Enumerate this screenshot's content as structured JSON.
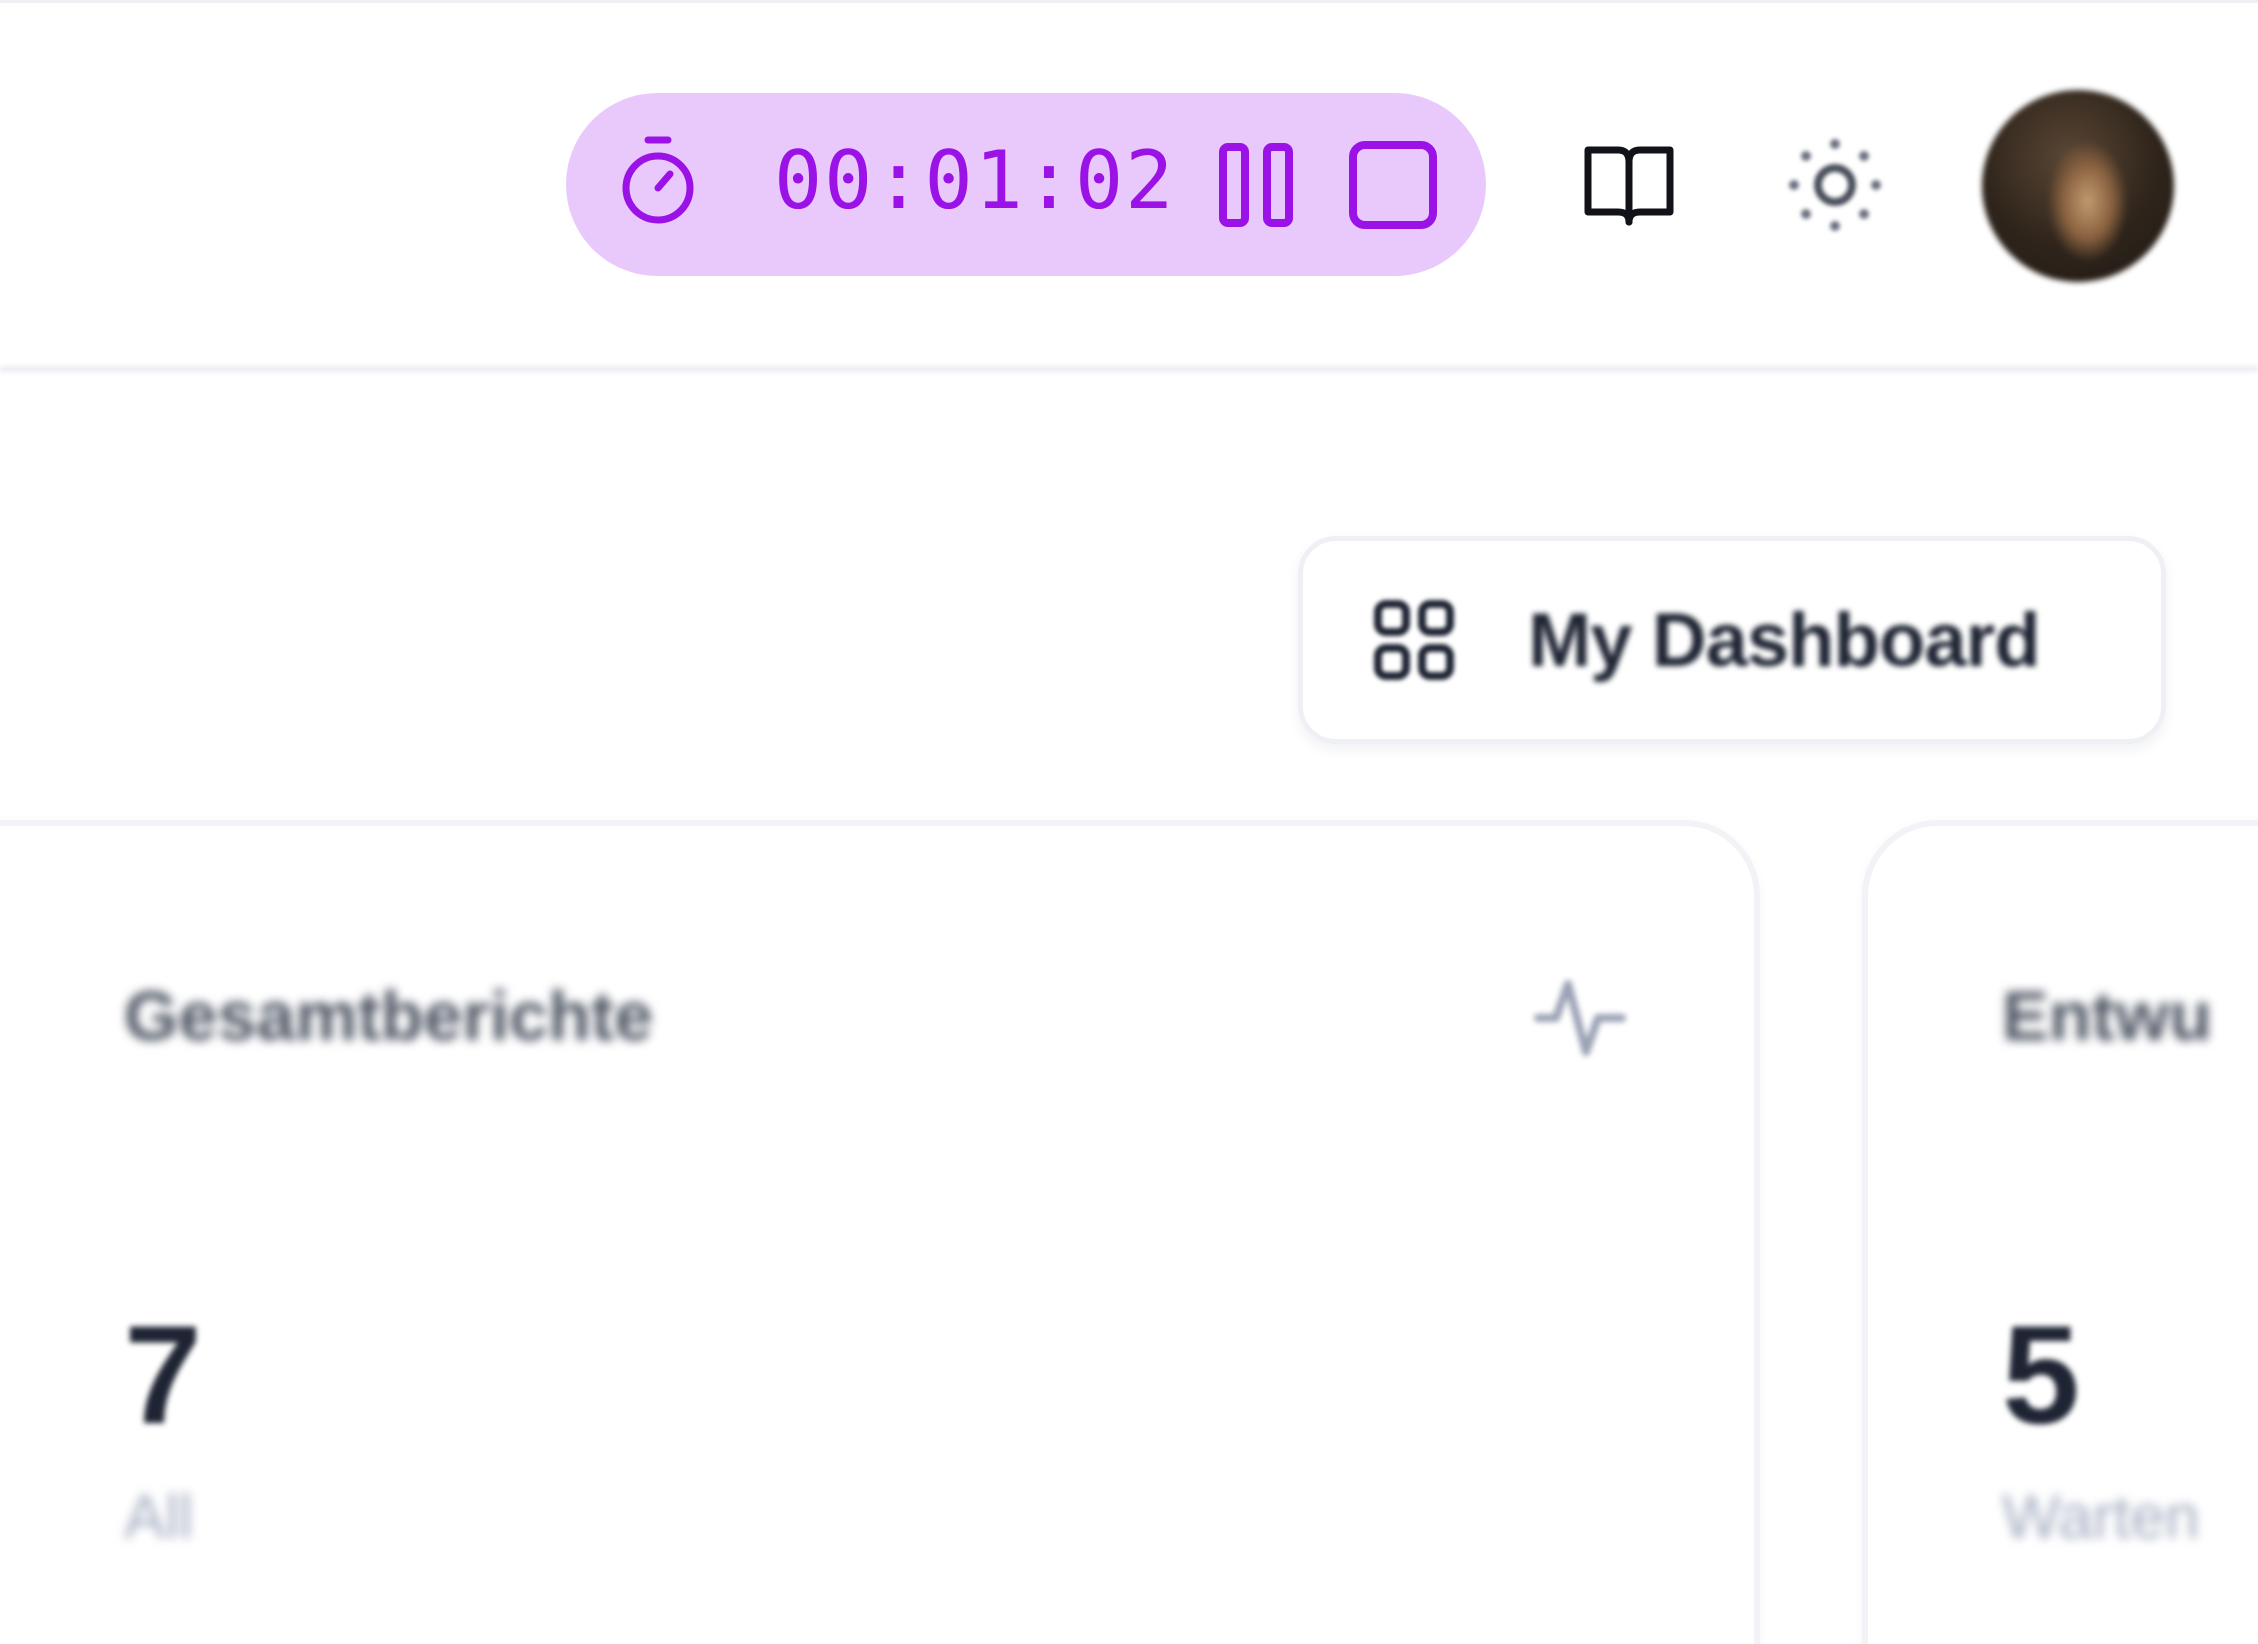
{
  "header": {
    "timer": {
      "elapsed": "00:01:02",
      "icon": "stopwatch-icon",
      "pause_icon": "pause-icon",
      "stop_icon": "stop-icon",
      "accent_color": "#9a12e6",
      "background_color": "#e9c9fc"
    },
    "icons": [
      "book-open-icon",
      "sun-icon",
      "user-avatar"
    ]
  },
  "toolbar": {
    "dashboard_label": "My Dashboard",
    "dashboard_icon": "grid-icon"
  },
  "cards": [
    {
      "title": "Gesamtberichte",
      "icon": "activity-icon",
      "value": "7",
      "subtitle": "All"
    },
    {
      "title": "Entwu",
      "value": "5",
      "subtitle": "Warten"
    }
  ]
}
